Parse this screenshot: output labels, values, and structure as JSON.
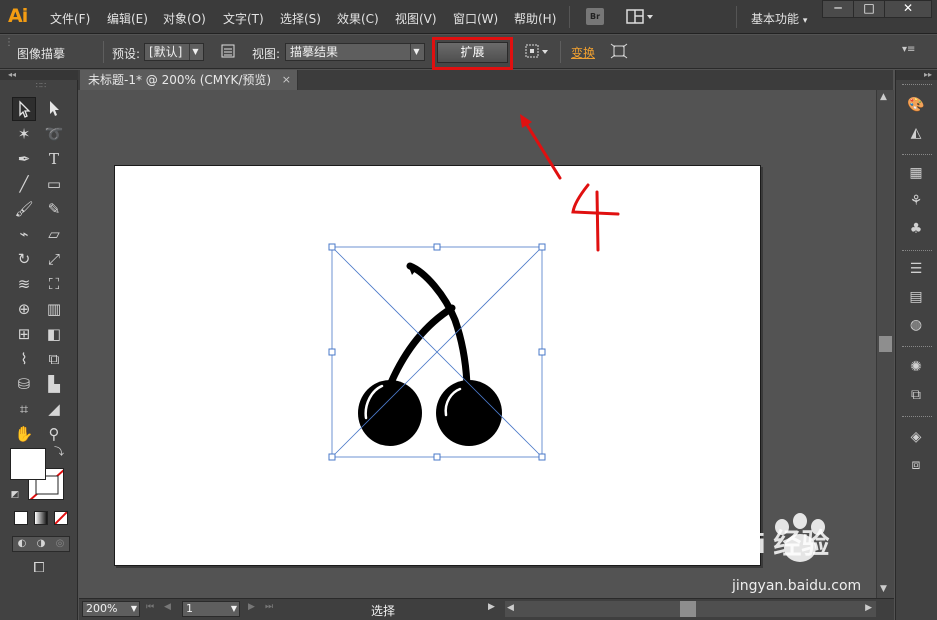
{
  "app": {
    "logo": "Ai"
  },
  "menus": [
    "文件(F)",
    "编辑(E)",
    "对象(O)",
    "文字(T)",
    "选择(S)",
    "效果(C)",
    "视图(V)",
    "窗口(W)",
    "帮助(H)"
  ],
  "bridge_label": "Br",
  "workspace": "基本功能",
  "window_controls": {
    "minimize": "─",
    "maximize": "□",
    "close": "✕"
  },
  "control_bar": {
    "panel_name": "图像描摹",
    "preset_label": "预设:",
    "preset_value": "[默认]",
    "view_label": "视图:",
    "view_value": "描摹结果",
    "expand_button": "扩展",
    "transform_link": "变换"
  },
  "document_tab": {
    "title": "未标题-1* @ 200% (CMYK/预览)",
    "close": "×"
  },
  "status_bar": {
    "zoom": "200%",
    "page": "1",
    "status": "选择"
  },
  "annotation": {
    "text": "4",
    "color": "#e01010"
  },
  "watermark": {
    "logo": "Bai  经验",
    "url": "jingyan.baidu.com"
  },
  "colors": {
    "accent": "#f39c12",
    "highlight": "#e01010",
    "selection": "#4a78c8"
  }
}
